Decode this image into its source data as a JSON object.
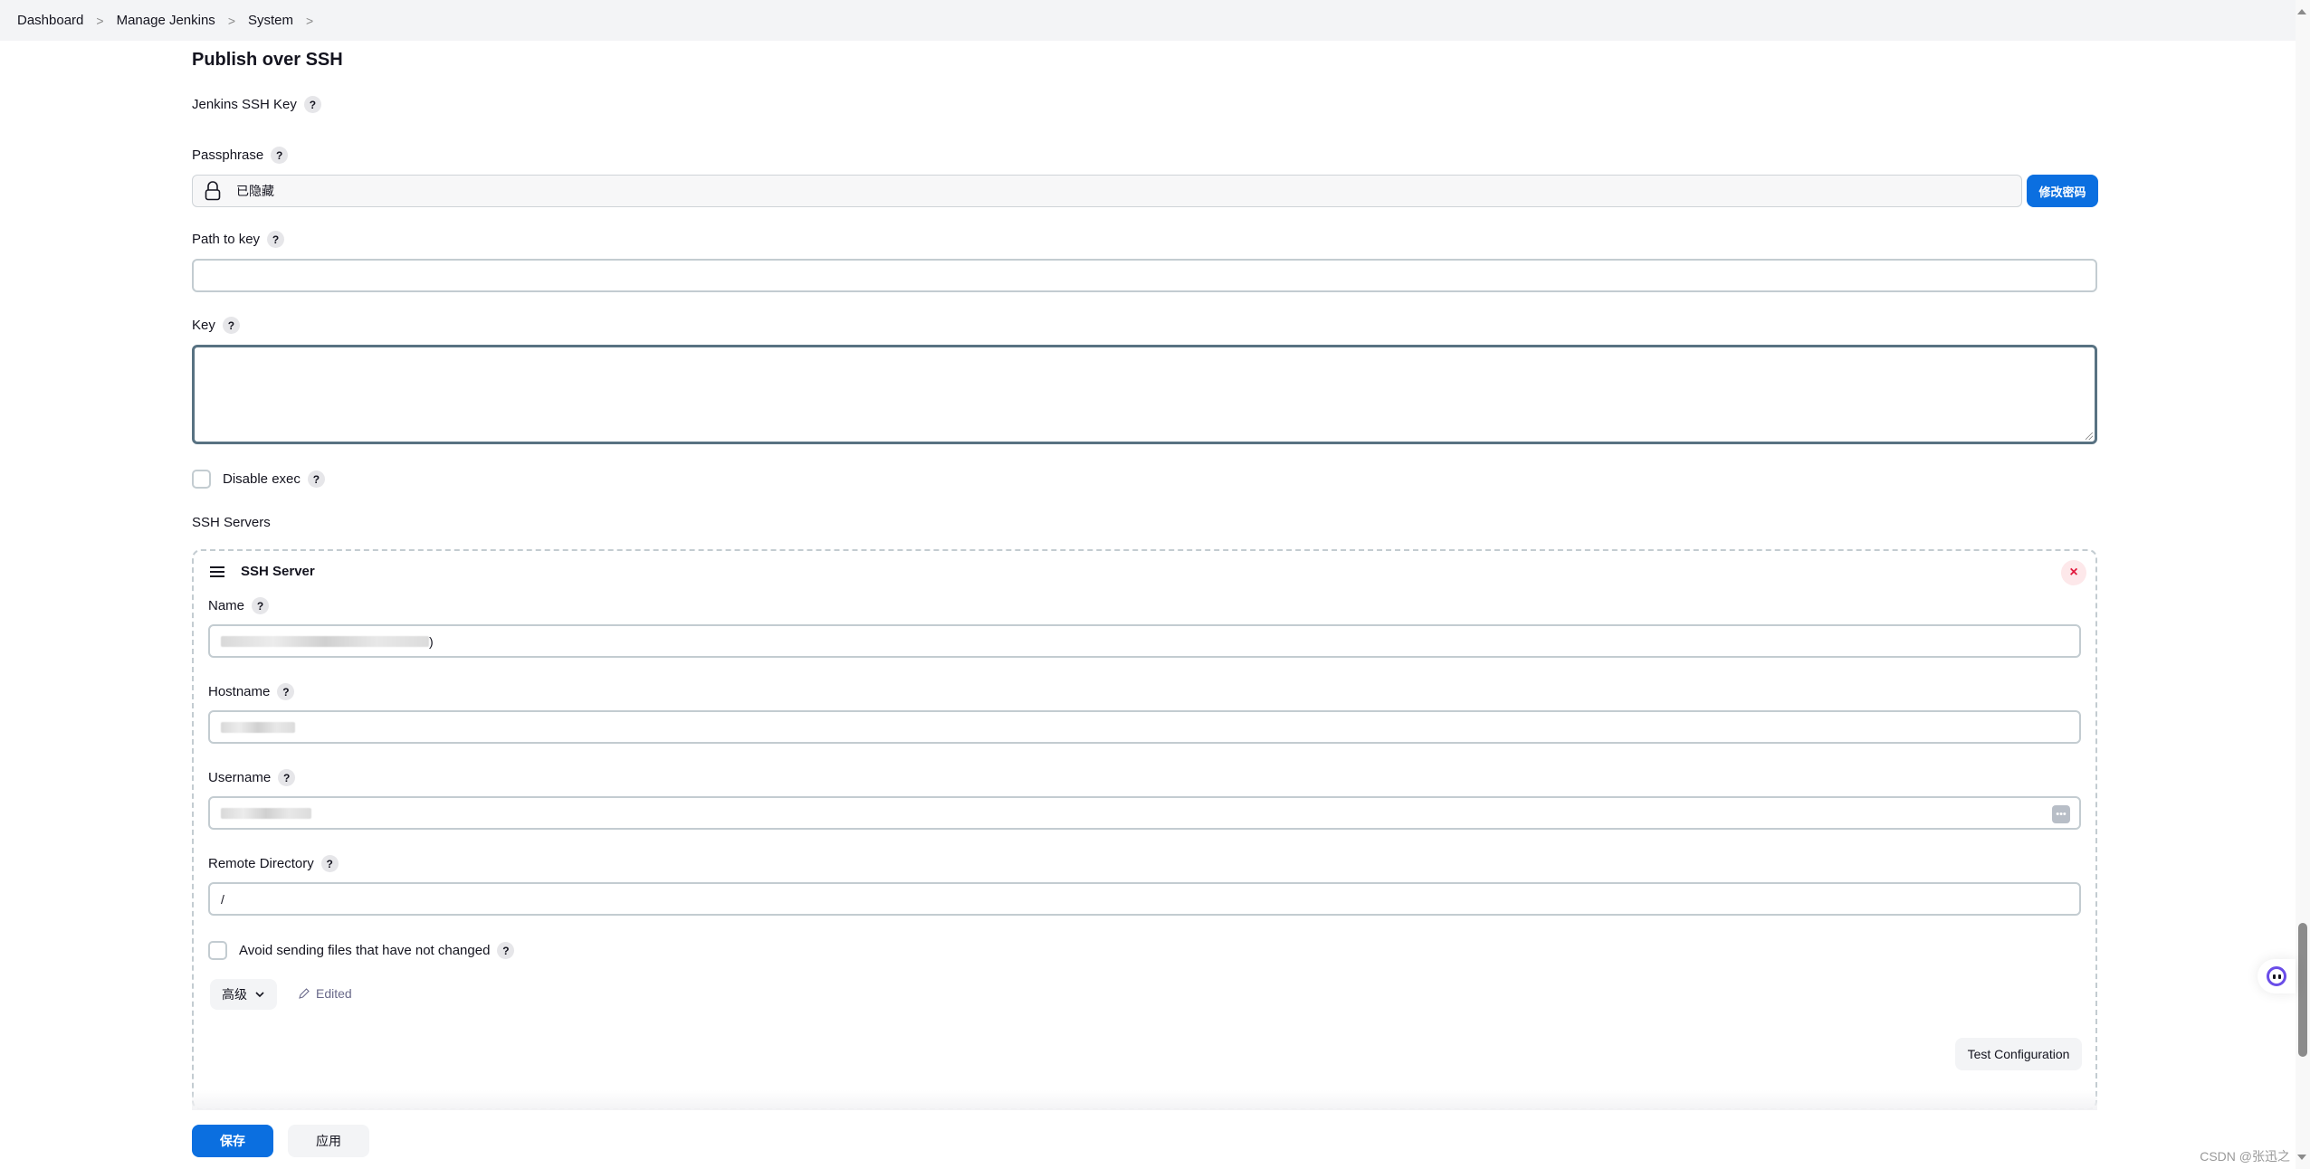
{
  "breadcrumb": {
    "items": [
      "Dashboard",
      "Manage Jenkins",
      "System"
    ],
    "separator": ">"
  },
  "section": {
    "title": "Publish over SSH",
    "help_glyph": "?"
  },
  "fields": {
    "jenkins_ssh_key_label": "Jenkins SSH Key",
    "passphrase_label": "Passphrase",
    "passphrase_value": "已隐藏",
    "change_password_label": "修改密码",
    "path_to_key_label": "Path to key",
    "path_to_key_value": "",
    "key_label": "Key",
    "key_value": "",
    "disable_exec_label": "Disable exec",
    "disable_exec_checked": false,
    "ssh_servers_label": "SSH Servers"
  },
  "ssh_server": {
    "header": "SSH Server",
    "close_glyph": "×",
    "name_label": "Name",
    "name_value_trailing": ")",
    "hostname_label": "Hostname",
    "username_label": "Username",
    "remote_directory_label": "Remote Directory",
    "remote_directory_value": "/",
    "avoid_sending_label": "Avoid sending files that have not changed",
    "avoid_sending_checked": false,
    "advanced_label": "高级",
    "edited_label": "Edited",
    "test_configuration_label": "Test Configuration",
    "dots_glyph": "•••"
  },
  "footer": {
    "save_label": "保存",
    "apply_label": "应用"
  },
  "watermark": "CSDN @张迅之",
  "colors": {
    "primary": "#0b6fe0",
    "danger": "#e0183c",
    "focus_border": "#587282"
  }
}
